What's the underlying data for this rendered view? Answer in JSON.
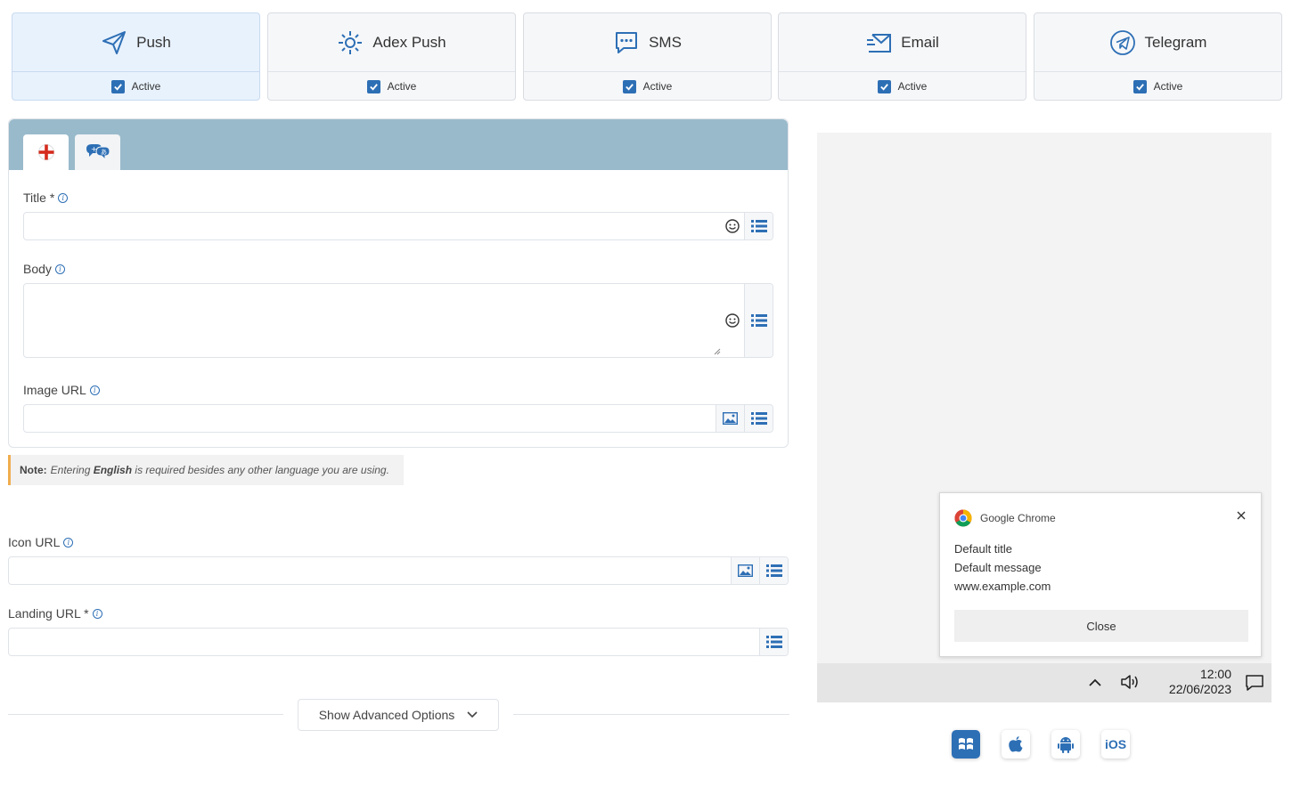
{
  "channels": [
    {
      "name": "Push",
      "icon": "paper-plane-icon",
      "status": "Active",
      "checked": true,
      "selected": true
    },
    {
      "name": "Adex Push",
      "icon": "adex-burst-icon",
      "status": "Active",
      "checked": true,
      "selected": false
    },
    {
      "name": "SMS",
      "icon": "chat-bubble-icon",
      "status": "Active",
      "checked": true,
      "selected": false
    },
    {
      "name": "Email",
      "icon": "envelope-icon",
      "status": "Active",
      "checked": true,
      "selected": false
    },
    {
      "name": "Telegram",
      "icon": "telegram-icon",
      "status": "Active",
      "checked": true,
      "selected": false
    }
  ],
  "language_tabs": [
    {
      "icon": "england-flag-icon",
      "active": true
    },
    {
      "icon": "translate-languages-icon",
      "active": false
    }
  ],
  "form": {
    "title_label": "Title *",
    "title_value": "",
    "body_label": "Body",
    "body_value": "",
    "image_url_label": "Image URL",
    "image_url_value": "",
    "icon_url_label": "Icon URL",
    "icon_url_value": "",
    "landing_url_label": "Landing URL *",
    "landing_url_value": ""
  },
  "note": {
    "prefix": "Note:",
    "text_1": "Entering",
    "emphasis": "English",
    "text_2": "is required besides any other language you are using."
  },
  "advanced": {
    "label": "Show Advanced Options"
  },
  "preview": {
    "app_name": "Google Chrome",
    "title": "Default title",
    "message": "Default message",
    "domain": "www.example.com",
    "close_label": "Close",
    "time": "12:00",
    "date": "22/06/2023"
  },
  "os_options": [
    {
      "name": "windows-icon",
      "label": "",
      "active": true
    },
    {
      "name": "apple-icon",
      "label": "",
      "active": false
    },
    {
      "name": "android-icon",
      "label": "",
      "active": false
    },
    {
      "name": "ios-option",
      "label": "iOS",
      "active": false
    }
  ],
  "colors": {
    "accent": "#2d6fb5",
    "selected_card": "#e8f2fd",
    "panel_header": "#99bacb",
    "note_border": "#f0ad4e"
  }
}
